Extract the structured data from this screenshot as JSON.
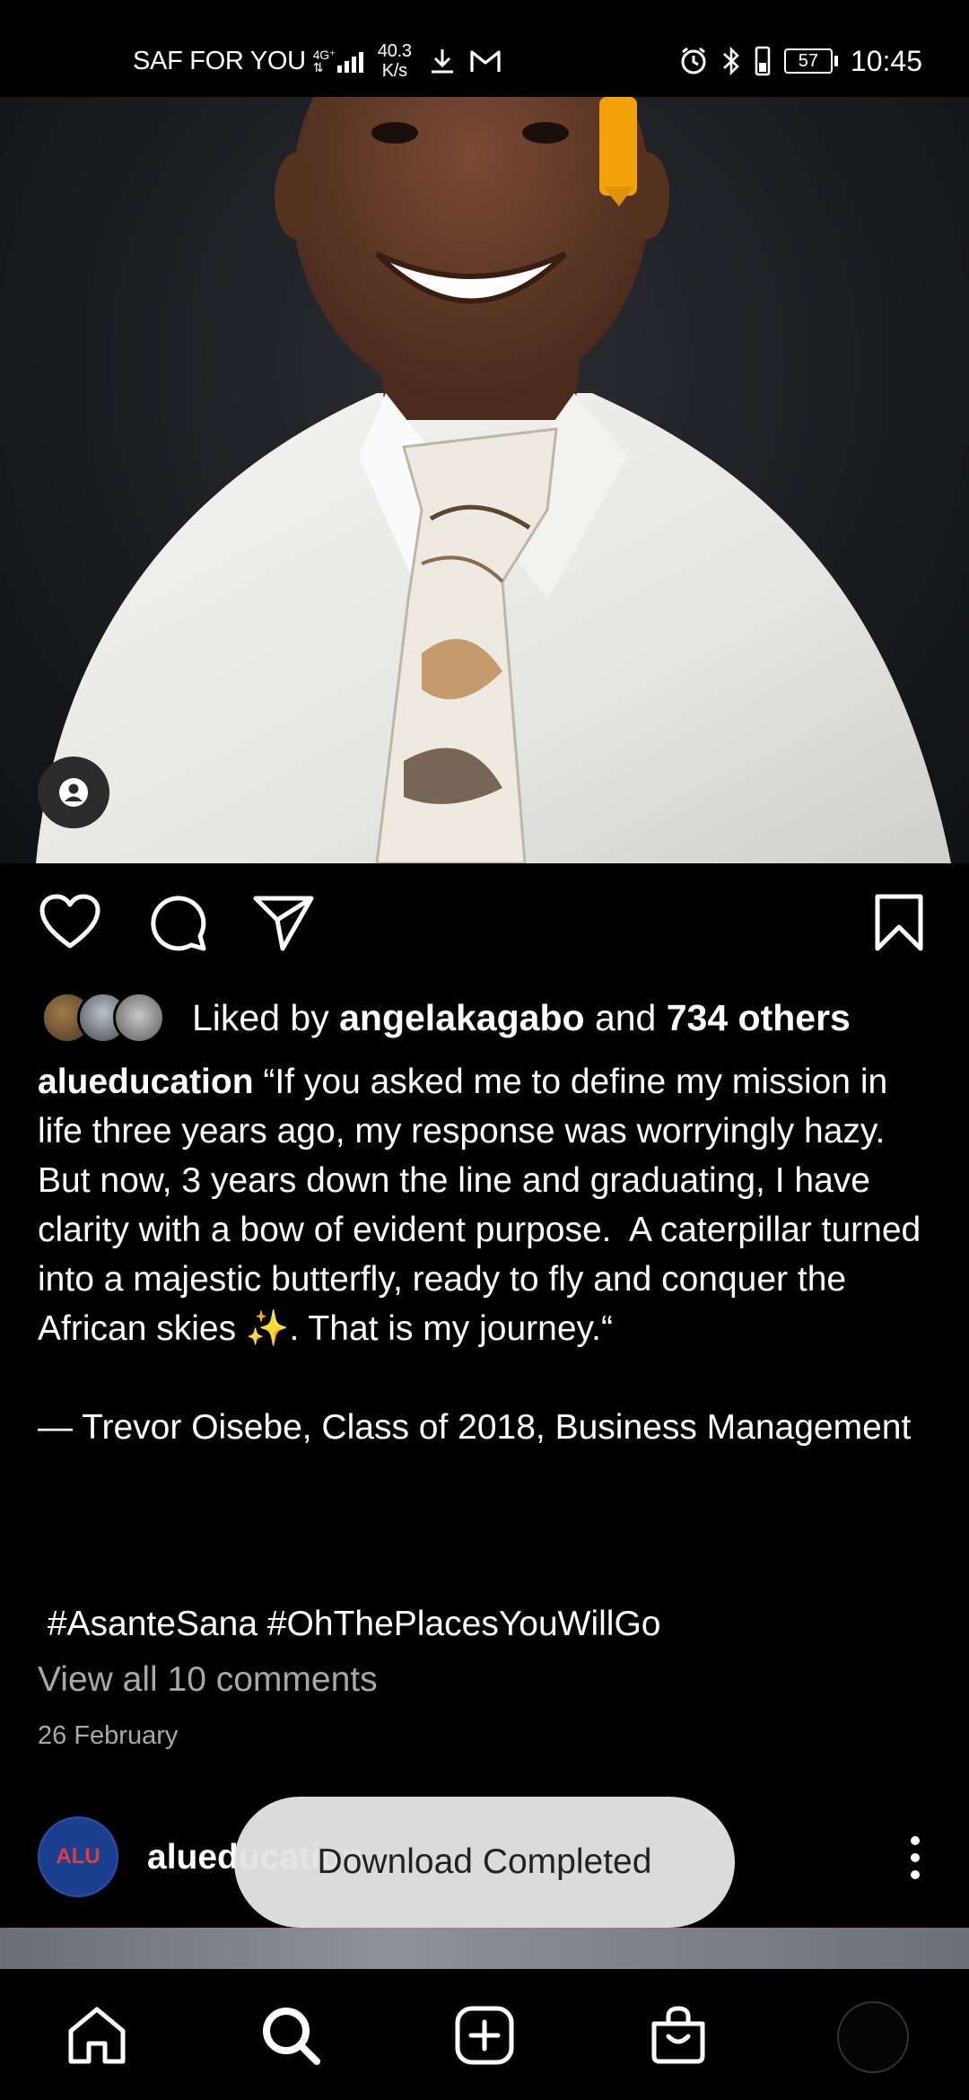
{
  "status_bar": {
    "carrier": "SAF FOR YOU",
    "network_type": "4G⁺",
    "speed_value": "40.3",
    "speed_unit": "K/s",
    "battery": "57",
    "time": "10:45"
  },
  "post": {
    "likes": {
      "prefix": "Liked by ",
      "user": "angelakagabo",
      "middle": " and ",
      "others": "734 others"
    },
    "caption": {
      "username": "alueducation",
      "text": " “If you asked me to define my mission in life three years ago, my response was worryingly hazy. But now, 3 years down the line and graduating, I have clarity with a bow of evident purpose.  A caterpillar turned into a majestic butterfly, ready to fly and conquer the African skies ✨. That is my journey.“\n\n— Trevor Oisebe, Class of 2018, Business Management"
    },
    "hashtags": " #AsanteSana #OhThePlacesYouWillGo",
    "view_comments": "View all 10 comments",
    "date": "26 February"
  },
  "next_post": {
    "avatar_text": "ALU",
    "username": "alueducation"
  },
  "toast": {
    "message": "Download Completed"
  },
  "colors": {
    "background": "#000000",
    "secondary_text": "#a8a8a8",
    "toast_bg": "#e4e4e4",
    "alu_blue": "#1d3f8f"
  },
  "icons": {
    "like": "heart-icon",
    "comment": "comment-bubble-icon",
    "share": "paper-plane-icon",
    "save": "bookmark-icon",
    "home": "home-icon",
    "search": "search-icon",
    "create": "plus-square-icon",
    "shop": "shopping-bag-icon",
    "more": "more-vertical-icon",
    "tags": "person-tag-icon"
  }
}
